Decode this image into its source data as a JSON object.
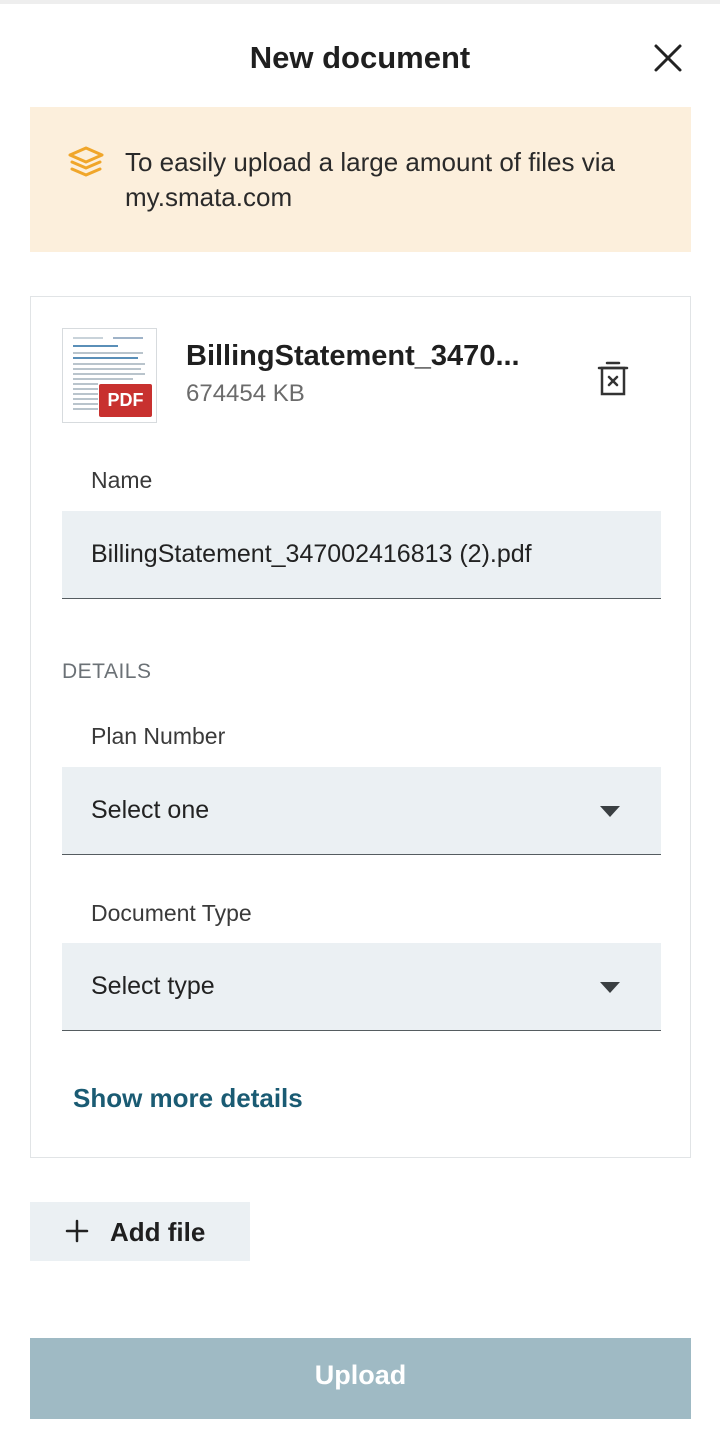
{
  "header": {
    "title": "New document"
  },
  "banner": {
    "text": "To easily upload a large amount of files via my.smata.com"
  },
  "file": {
    "name": "BillingStatement_3470...",
    "size": "674454 KB",
    "badge": "PDF"
  },
  "form": {
    "name_label": "Name",
    "name_value": "BillingStatement_347002416813 (2).pdf",
    "details_heading": "DETAILS",
    "plan_label": "Plan Number",
    "plan_value": "Select one",
    "type_label": "Document Type",
    "type_value": "Select type",
    "more_link": "Show more details"
  },
  "actions": {
    "add_file": "Add file",
    "upload": "Upload"
  },
  "colors": {
    "banner_bg": "#fcefdc",
    "banner_icon": "#f0a62a",
    "input_bg": "#ebf0f3",
    "link": "#1a5b73",
    "upload_disabled": "#9fbac4",
    "pdf_badge": "#c8312f"
  },
  "icons": {
    "close": "close-icon",
    "layers": "layers-icon",
    "trash": "delete-file-icon",
    "caret": "chevron-down-icon",
    "plus": "plus-icon"
  }
}
